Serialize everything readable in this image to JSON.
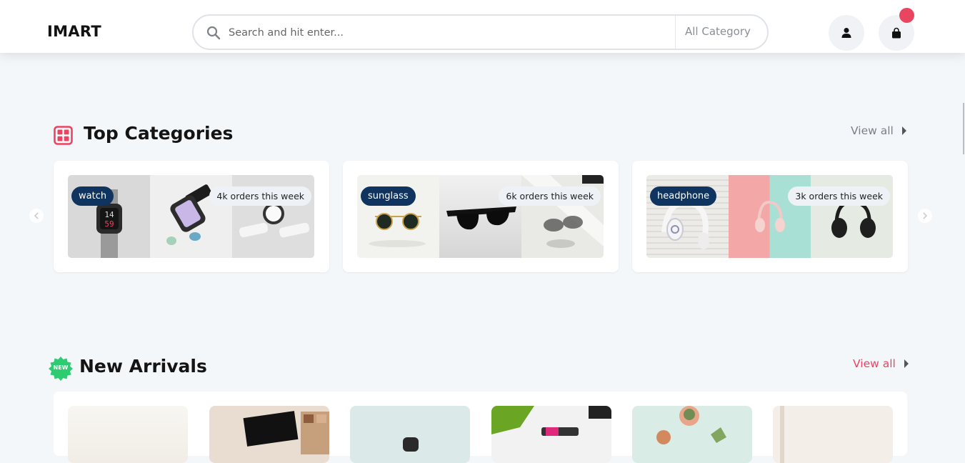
{
  "header": {
    "logo": "IMART",
    "search": {
      "placeholder": "Search and hit enter...",
      "category": "All Category"
    }
  },
  "icons": {
    "search": "search-icon",
    "user": "user-icon",
    "cart": "shopping-bag-icon",
    "categories": "grid-icon",
    "new": "new-badge-icon"
  },
  "colors": {
    "accent": "#e94560",
    "tag": "#0f3460",
    "background": "#f4f7fa"
  },
  "top_categories": {
    "title": "Top Categories",
    "view_all": "View all",
    "items": [
      {
        "tag": "watch",
        "orders": "4k orders this week"
      },
      {
        "tag": "sunglass",
        "orders": "6k orders this week"
      },
      {
        "tag": "headphone",
        "orders": "3k orders this week"
      }
    ]
  },
  "new_arrivals": {
    "title": "New Arrivals",
    "badge": "NEW",
    "view_all": "View all"
  }
}
